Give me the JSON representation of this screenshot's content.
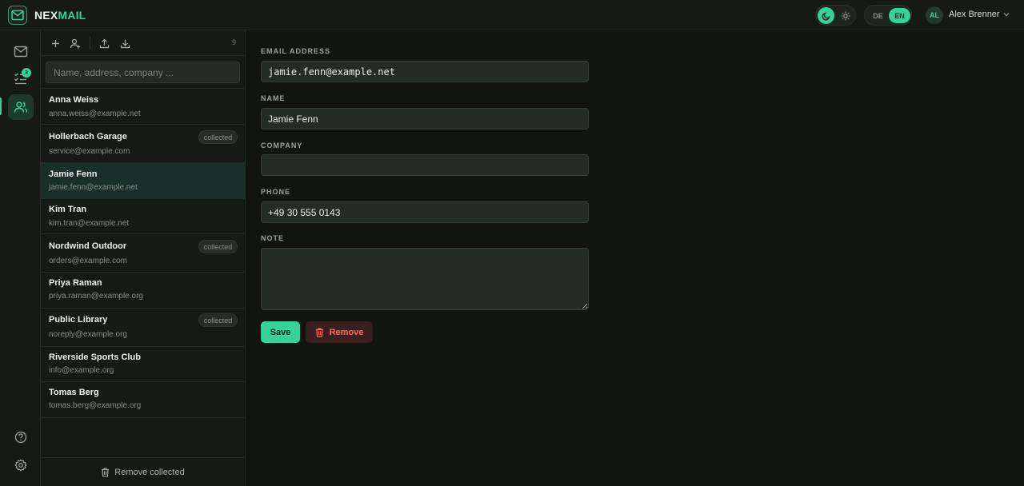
{
  "app": {
    "brand_prefix": "NEX",
    "brand_suffix": "MAIL"
  },
  "header": {
    "theme": {
      "active": "dark"
    },
    "languages": [
      "DE",
      "EN"
    ],
    "active_language": "EN",
    "user": {
      "initials": "AL",
      "name": "Alex Brenner"
    }
  },
  "rail": {
    "items": [
      {
        "icon": "mail-icon"
      },
      {
        "icon": "tasks-icon",
        "badge": "3"
      },
      {
        "icon": "contacts-icon",
        "active": true
      }
    ],
    "bottom": [
      {
        "icon": "help-icon"
      },
      {
        "icon": "gear-icon"
      }
    ]
  },
  "contacts": {
    "count": "9",
    "search_placeholder": "Name, address, company ...",
    "items": [
      {
        "name": "Anna Weiss",
        "email": "anna.weiss@example.net",
        "tag": ""
      },
      {
        "name": "Hollerbach Garage",
        "email": "service@example.com",
        "tag": "collected"
      },
      {
        "name": "Jamie Fenn",
        "email": "jamie.fenn@example.net",
        "tag": "",
        "active": true
      },
      {
        "name": "Kim Tran",
        "email": "kim.tran@example.net",
        "tag": ""
      },
      {
        "name": "Nordwind Outdoor",
        "email": "orders@example.com",
        "tag": "collected"
      },
      {
        "name": "Priya Raman",
        "email": "priya.raman@example.org",
        "tag": ""
      },
      {
        "name": "Public Library",
        "email": "noreply@example.org",
        "tag": "collected"
      },
      {
        "name": "Riverside Sports Club",
        "email": "info@example.org",
        "tag": ""
      },
      {
        "name": "Tomas Berg",
        "email": "tomas.berg@example.org",
        "tag": ""
      }
    ],
    "footer_label": "Remove collected"
  },
  "form": {
    "email_label": "EMAIL ADDRESS",
    "email_value": "jamie.fenn@example.net",
    "name_label": "NAME",
    "name_value": "Jamie Fenn",
    "company_label": "COMPANY",
    "company_value": "",
    "phone_label": "PHONE",
    "phone_value": "+49 30 555 0143",
    "note_label": "NOTE",
    "note_value": "",
    "save_label": "Save",
    "remove_label": "Remove"
  },
  "colors": {
    "accent": "#35d39a",
    "background": "#121412",
    "panel": "#161a17",
    "danger": "#ff6b6b"
  }
}
